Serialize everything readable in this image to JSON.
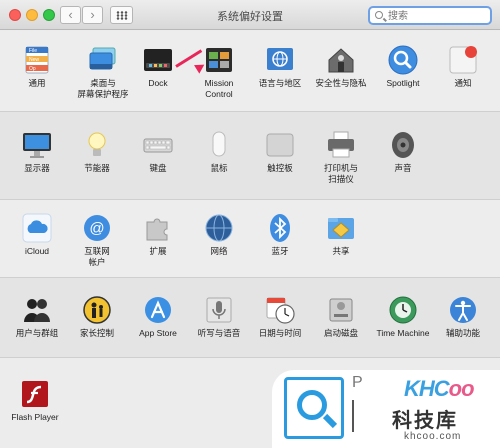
{
  "window": {
    "title": "系统偏好设置",
    "search_placeholder": "搜索",
    "nav_back": "‹",
    "nav_forward": "›"
  },
  "sections": [
    {
      "items": [
        {
          "id": "general",
          "label": "通用",
          "label2": "",
          "icon": "general-icon"
        },
        {
          "id": "desktop",
          "label": "桌面与",
          "label2": "屏幕保护程序",
          "icon": "desktop-screensaver-icon"
        },
        {
          "id": "dock",
          "label": "Dock",
          "label2": "",
          "icon": "dock-icon"
        },
        {
          "id": "mission",
          "label": "Mission",
          "label2": "Control",
          "icon": "mission-control-icon"
        },
        {
          "id": "language",
          "label": "语言与地区",
          "label2": "",
          "icon": "language-region-icon"
        },
        {
          "id": "security",
          "label": "安全性与隐私",
          "label2": "",
          "icon": "security-privacy-icon"
        },
        {
          "id": "spotlight",
          "label": "Spotlight",
          "label2": "",
          "icon": "spotlight-icon"
        },
        {
          "id": "notifications",
          "label": "通知",
          "label2": "",
          "icon": "notifications-icon"
        }
      ]
    },
    {
      "items": [
        {
          "id": "displays",
          "label": "显示器",
          "label2": "",
          "icon": "displays-icon"
        },
        {
          "id": "energy",
          "label": "节能器",
          "label2": "",
          "icon": "energy-saver-icon"
        },
        {
          "id": "keyboard",
          "label": "键盘",
          "label2": "",
          "icon": "keyboard-icon"
        },
        {
          "id": "mouse",
          "label": "鼠标",
          "label2": "",
          "icon": "mouse-icon"
        },
        {
          "id": "trackpad",
          "label": "触控板",
          "label2": "",
          "icon": "trackpad-icon"
        },
        {
          "id": "printers",
          "label": "打印机与",
          "label2": "扫描仪",
          "icon": "printer-icon"
        },
        {
          "id": "sound",
          "label": "声音",
          "label2": "",
          "icon": "sound-icon"
        }
      ]
    },
    {
      "items": [
        {
          "id": "icloud",
          "label": "iCloud",
          "label2": "",
          "icon": "icloud-icon"
        },
        {
          "id": "internet",
          "label": "互联网",
          "label2": "帐户",
          "icon": "internet-accounts-icon"
        },
        {
          "id": "extensions",
          "label": "扩展",
          "label2": "",
          "icon": "extensions-icon"
        },
        {
          "id": "network",
          "label": "网络",
          "label2": "",
          "icon": "network-icon"
        },
        {
          "id": "bluetooth",
          "label": "蓝牙",
          "label2": "",
          "icon": "bluetooth-icon"
        },
        {
          "id": "sharing",
          "label": "共享",
          "label2": "",
          "icon": "sharing-icon"
        }
      ]
    },
    {
      "items": [
        {
          "id": "users",
          "label": "用户与群组",
          "label2": "",
          "icon": "users-groups-icon"
        },
        {
          "id": "parental",
          "label": "家长控制",
          "label2": "",
          "icon": "parental-controls-icon"
        },
        {
          "id": "appstore",
          "label": "App Store",
          "label2": "",
          "icon": "app-store-icon"
        },
        {
          "id": "dictation",
          "label": "听写与语音",
          "label2": "",
          "icon": "dictation-speech-icon"
        },
        {
          "id": "datetime",
          "label": "日期与时间",
          "label2": "",
          "icon": "date-time-icon"
        },
        {
          "id": "startup",
          "label": "启动磁盘",
          "label2": "",
          "icon": "startup-disk-icon"
        },
        {
          "id": "timemachine",
          "label": "Time Machine",
          "label2": "",
          "icon": "time-machine-icon"
        },
        {
          "id": "accessibility",
          "label": "辅助功能",
          "label2": "",
          "icon": "accessibility-icon"
        }
      ]
    },
    {
      "items": [
        {
          "id": "flash",
          "label": "Flash Player",
          "label2": "",
          "icon": "flash-player-icon"
        }
      ]
    }
  ],
  "general_icon_text": {
    "file": "File",
    "new": "New",
    "op": "Op"
  },
  "watermark": {
    "letter": "P",
    "brand_1": "KHC",
    "brand_2": "oo",
    "site_cn": "科技库",
    "site_en": "khcoo.com"
  },
  "colors": {
    "annotation_arrow": "#e8265a",
    "search_focus": "#6ea0e6"
  }
}
